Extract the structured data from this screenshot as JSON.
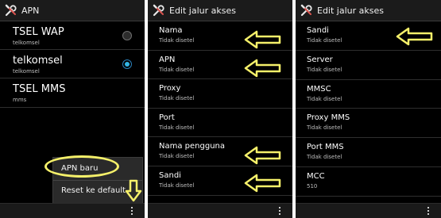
{
  "panels": [
    {
      "title": "APN",
      "items": [
        {
          "label": "TSEL WAP",
          "sub": "telkomsel",
          "selected": false
        },
        {
          "label": "telkomsel",
          "sub": "telkomsel",
          "selected": true
        },
        {
          "label": "TSEL MMS",
          "sub": "mms"
        }
      ],
      "menu": {
        "new_apn": "APN baru",
        "reset_default": "Reset ke default"
      }
    },
    {
      "title": "Edit jalur akses",
      "items": [
        {
          "label": "Nama",
          "sub": "Tidak disetel"
        },
        {
          "label": "APN",
          "sub": "Tidak disetel"
        },
        {
          "label": "Proxy",
          "sub": "Tidak disetel"
        },
        {
          "label": "Port",
          "sub": "Tidak disetel"
        },
        {
          "label": "Nama pengguna",
          "sub": "Tidak disetel"
        },
        {
          "label": "Sandi",
          "sub": "Tidak disetel"
        }
      ]
    },
    {
      "title": "Edit jalur akses",
      "items": [
        {
          "label": "Sandi",
          "sub": "Tidak disetel"
        },
        {
          "label": "Server",
          "sub": "Tidak disetel"
        },
        {
          "label": "MMSC",
          "sub": "Tidak disetel"
        },
        {
          "label": "Proxy MMS",
          "sub": "Tidak disetel"
        },
        {
          "label": "Port MMS",
          "sub": "Tidak disetel"
        },
        {
          "label": "MCC",
          "sub": "510"
        }
      ]
    }
  ],
  "colors": {
    "annotation": "#f5f06a",
    "radio_selected": "#33b5e5",
    "background": "#000000"
  },
  "icons": [
    "wrench-screwdriver-icon",
    "overflow-menu-icon",
    "arrow-left-icon",
    "arrow-down-icon"
  ]
}
